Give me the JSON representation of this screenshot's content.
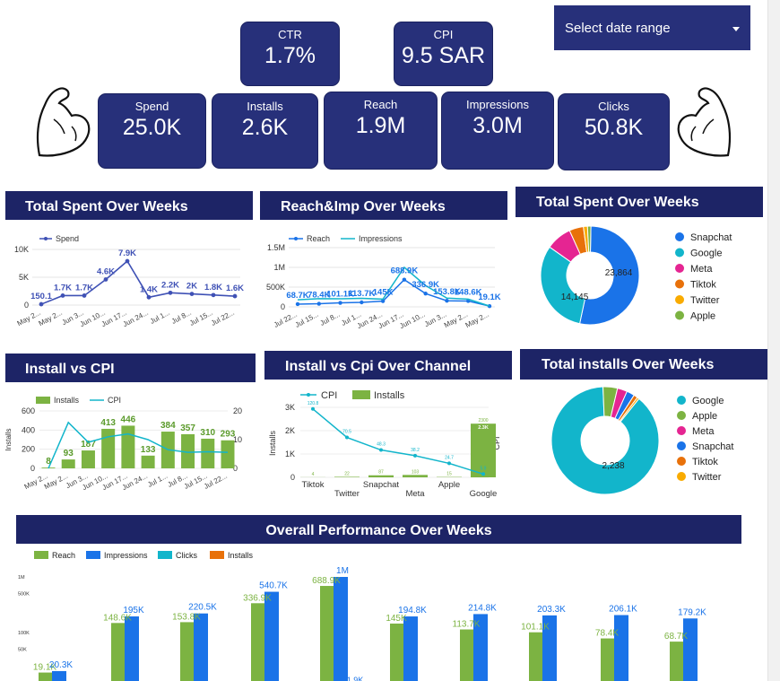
{
  "kpis": {
    "ctr": {
      "label": "CTR",
      "value": "1.7%"
    },
    "cpi": {
      "label": "CPI",
      "value": "9.5 SAR"
    },
    "spend": {
      "label": "Spend",
      "value": "25.0K"
    },
    "installs": {
      "label": "Installs",
      "value": "2.6K"
    },
    "reach": {
      "label": "Reach",
      "value": "1.9M"
    },
    "impressions": {
      "label": "Impressions",
      "value": "3.0M"
    },
    "clicks": {
      "label": "Clicks",
      "value": "50.8K"
    }
  },
  "date_range": {
    "label": "Select date range"
  },
  "icons": [
    "flexed-arm-icon",
    "flexed-arm-icon",
    "dropdown-caret-icon"
  ],
  "colors": {
    "kpi_bg": "#27307a",
    "title_bg": "#1d2466",
    "reach": "#7cb342",
    "impressions": "#1a73e8",
    "clicks": "#12b5cb",
    "installs": "#e8710a",
    "line": "#3f51b5"
  },
  "panel_titles": {
    "total_spent": "Total Spent Over Weeks",
    "reach_imp": "Reach&Imp Over Weeks",
    "total_spent_pie": "Total Spent Over Weeks",
    "install_cpi": "Install vs CPI",
    "install_channel": "Install vs Cpi Over Channel",
    "total_installs": "Total installs Over Weeks",
    "overall": "Overall Performance Over Weeks"
  },
  "chart_data": [
    {
      "type": "line",
      "title": "Total Spent Over Weeks",
      "x": [
        "May 2...",
        "May 2...",
        "Jun 3...",
        "Jun 10...",
        "Jun 17...",
        "Jun 24...",
        "Jul 1...",
        "Jul 8...",
        "Jul 15...",
        "Jul 22..."
      ],
      "series": [
        {
          "name": "Spend",
          "values": [
            150.1,
            1700,
            1700,
            4600,
            7900,
            1400,
            2200,
            2000,
            1800,
            1600
          ]
        }
      ],
      "data_labels": [
        "150.1",
        "1.7K",
        "1.7K",
        "4.6K",
        "7.9K",
        "1.4K",
        "2.2K",
        "2K",
        "1.8K",
        "1.6K"
      ],
      "y_ticks": [
        "0",
        "5K",
        "10K"
      ],
      "ylim": [
        0,
        10000
      ]
    },
    {
      "type": "line",
      "title": "Reach&Imp Over Weeks",
      "x": [
        "Jul 22...",
        "Jul 15...",
        "Jul 8...",
        "Jul 1...",
        "Jun 24...",
        "Jun 17...",
        "Jun 10...",
        "Jun 3...",
        "May 2...",
        "May 2..."
      ],
      "series": [
        {
          "name": "Reach",
          "values": [
            68700,
            78400,
            101100,
            113700,
            145000,
            688900,
            336900,
            153800,
            148600,
            19100
          ]
        },
        {
          "name": "Impressions",
          "values": [
            179200,
            206100,
            203300,
            214800,
            194800,
            1000000,
            540700,
            220500,
            195000,
            20300
          ]
        }
      ],
      "data_labels": [
        "68.7K",
        "78.4K",
        "101.1K",
        "113.7K",
        "145K",
        "688.9K",
        "336.9K",
        "153.8K",
        "148.6K",
        "19.1K"
      ],
      "y_ticks": [
        "0",
        "500K",
        "1M",
        "1.5M"
      ],
      "ylim": [
        0,
        1500000
      ]
    },
    {
      "type": "pie",
      "title": "Total Spent Over Weeks",
      "categories": [
        "Snapchat",
        "Google",
        "Meta",
        "Tiktok",
        "Twitter",
        "Apple"
      ],
      "values": [
        23864,
        14145,
        3800,
        2100,
        600,
        500
      ],
      "data_labels": [
        "23,864",
        "14,145"
      ],
      "legend": "right"
    },
    {
      "type": "bar",
      "title": "Install vs CPI",
      "categories": [
        "May 2...",
        "May 2...",
        "Jun 3...",
        "Jun 10...",
        "Jun 17...",
        "Jun 24...",
        "Jul 1...",
        "Jul 8...",
        "Jul 15...",
        "Jul 22..."
      ],
      "series": [
        {
          "name": "Installs",
          "values": [
            8,
            93,
            187,
            413,
            446,
            133,
            384,
            357,
            310,
            293
          ]
        },
        {
          "name": "CPI",
          "values": [
            0,
            16,
            9.1,
            11,
            12,
            10,
            6.5,
            5.6,
            5.8,
            5.6
          ]
        }
      ],
      "data_labels": [
        "8",
        "93",
        "187",
        "413",
        "446",
        "133",
        "384",
        "357",
        "310",
        "293"
      ],
      "ylabel": "Installs",
      "y_ticks": [
        "0",
        "200",
        "400",
        "600"
      ],
      "y2_ticks": [
        "0",
        "10",
        "20"
      ],
      "ylim": [
        0,
        600
      ]
    },
    {
      "type": "bar",
      "title": "Install vs Cpi Over Channel",
      "categories": [
        "Tiktok",
        "Twitter",
        "Snapchat",
        "Meta",
        "Apple",
        "Google"
      ],
      "series": [
        {
          "name": "CPI",
          "values": [
            120.8,
            70.5,
            48.3,
            38.2,
            24.7,
            5.9
          ]
        },
        {
          "name": "Installs",
          "values": [
            4,
            22,
            87,
            103,
            15,
            2300
          ]
        }
      ],
      "data_labels": [
        "120.8",
        "70.5",
        "48.3",
        "38.2",
        "24.7",
        "5.9",
        "2.3K"
      ],
      "ylabel": "Installs",
      "y2label": "CPI",
      "y_ticks": [
        "0",
        "1K",
        "2K",
        "3K"
      ],
      "ylim": [
        0,
        3000
      ]
    },
    {
      "type": "pie",
      "title": "Total installs Over Weeks",
      "categories": [
        "Google",
        "Apple",
        "Meta",
        "Snapchat",
        "Tiktok",
        "Twitter"
      ],
      "values": [
        2238,
        110,
        75,
        60,
        30,
        15
      ],
      "data_labels": [
        "2,238"
      ],
      "legend": "right"
    },
    {
      "type": "bar",
      "title": "Overall Performance Over Weeks",
      "categories": [
        "May 2...",
        "May 2...",
        "Jun 3...",
        "Jun 10...",
        "Jun 17...",
        "Jun 24...",
        "Jul 1...",
        "Jul 8...",
        "Jul 15...",
        "Jul 22..."
      ],
      "series": [
        {
          "name": "Reach",
          "values": [
            19100,
            148600,
            153800,
            336900,
            688900,
            145000,
            113700,
            101100,
            78400,
            68700
          ]
        },
        {
          "name": "Impressions",
          "values": [
            20300,
            195000,
            220500,
            540700,
            1000000,
            194800,
            214800,
            203300,
            206100,
            179200
          ]
        },
        {
          "name": "Clicks",
          "values": []
        },
        {
          "name": "Installs",
          "values": []
        }
      ],
      "reach_labels": [
        "19.1K",
        "148.6K",
        "153.8K",
        "336.9K",
        "688.9K",
        "145K",
        "113.7K",
        "101.1K",
        "78.4K",
        "68.7K"
      ],
      "imp_labels": [
        "20.3K",
        "195K",
        "220.5K",
        "540.7K",
        "1M",
        "194.8K",
        "214.8K",
        "203.3K",
        "206.1K",
        "179.2K"
      ],
      "extra_label": "1.9K",
      "y_ticks": [
        "5M",
        "1M",
        "500K",
        "100K",
        "50K"
      ],
      "log_scale": true
    }
  ]
}
